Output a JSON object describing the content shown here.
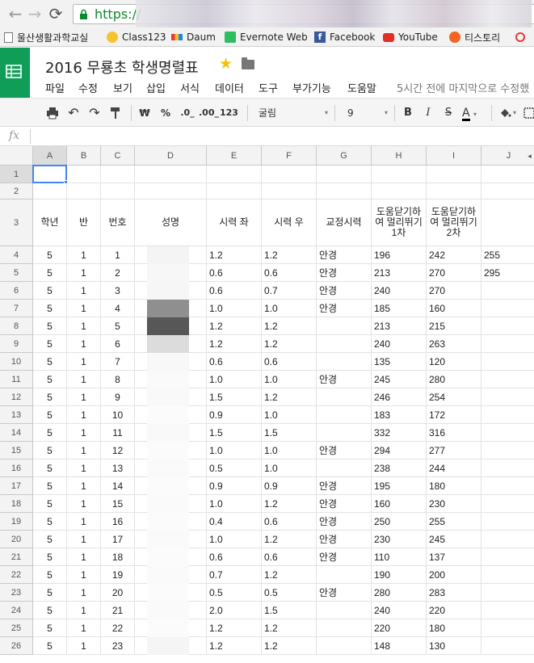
{
  "browser": {
    "url": "https://",
    "bookmarks": [
      {
        "label": "울산생활과학교실",
        "icon": "page-icon"
      },
      {
        "label": "Class123",
        "icon": "class123-icon"
      },
      {
        "label": "Daum",
        "icon": "daum-icon"
      },
      {
        "label": "Evernote Web",
        "icon": "evernote-icon"
      },
      {
        "label": "Facebook",
        "icon": "facebook-icon"
      },
      {
        "label": "YouTube",
        "icon": "youtube-icon"
      },
      {
        "label": "티스토리",
        "icon": "tistory-icon"
      }
    ]
  },
  "doc": {
    "title": "2016 무룡초 학생명렬표",
    "last_edit": "5시간 전에 마지막으로 수정했"
  },
  "menu": [
    "파일",
    "수정",
    "보기",
    "삽입",
    "서식",
    "데이터",
    "도구",
    "부가기능",
    "도움말"
  ],
  "toolbar": {
    "currency": "₩",
    "percent": "%",
    "decimal_decrease": ".0_",
    "decimal_increase": ".00_",
    "number_format": "123",
    "font": "굴림",
    "font_size": "9",
    "bold": "B",
    "italic": "I",
    "strike": "S",
    "text_color": "A"
  },
  "formula_bar": {
    "fx": "fx",
    "value": ""
  },
  "columns": [
    "A",
    "B",
    "C",
    "D",
    "E",
    "F",
    "G",
    "H",
    "I",
    "J"
  ],
  "header_row": [
    "학년",
    "반",
    "번호",
    "성명",
    "시력 좌",
    "시력 우",
    "교정시력",
    "도움닫기하여 멀리뛰기 1차",
    "도움닫기하여 멀리뛰기 2차",
    ""
  ],
  "row_numbers": [
    "1",
    "2",
    "3",
    "4",
    "5",
    "6",
    "7",
    "8",
    "9",
    "10",
    "11",
    "12",
    "13",
    "14",
    "15",
    "16",
    "17",
    "18",
    "19",
    "20",
    "21",
    "22",
    "23",
    "24",
    "25",
    "26"
  ],
  "rows": [
    [
      "5",
      "1",
      "1",
      "",
      "1.2",
      "1.2",
      "안경",
      "196",
      "242",
      "255"
    ],
    [
      "5",
      "1",
      "2",
      "",
      "0.6",
      "0.6",
      "안경",
      "213",
      "270",
      "295"
    ],
    [
      "5",
      "1",
      "3",
      "",
      "0.6",
      "0.7",
      "안경",
      "240",
      "270",
      ""
    ],
    [
      "5",
      "1",
      "4",
      "",
      "1.0",
      "1.0",
      "안경",
      "185",
      "160",
      ""
    ],
    [
      "5",
      "1",
      "5",
      "",
      "1.2",
      "1.2",
      "",
      "213",
      "215",
      ""
    ],
    [
      "5",
      "1",
      "6",
      "",
      "1.2",
      "1.2",
      "",
      "240",
      "263",
      ""
    ],
    [
      "5",
      "1",
      "7",
      "",
      "0.6",
      "0.6",
      "",
      "135",
      "120",
      ""
    ],
    [
      "5",
      "1",
      "8",
      "",
      "1.0",
      "1.0",
      "안경",
      "245",
      "280",
      ""
    ],
    [
      "5",
      "1",
      "9",
      "",
      "1.5",
      "1.2",
      "",
      "246",
      "254",
      ""
    ],
    [
      "5",
      "1",
      "10",
      "",
      "0.9",
      "1.0",
      "",
      "183",
      "172",
      ""
    ],
    [
      "5",
      "1",
      "11",
      "",
      "1.5",
      "1.5",
      "",
      "332",
      "316",
      ""
    ],
    [
      "5",
      "1",
      "12",
      "",
      "1.0",
      "1.0",
      "안경",
      "294",
      "277",
      ""
    ],
    [
      "5",
      "1",
      "13",
      "",
      "0.5",
      "1.0",
      "",
      "238",
      "244",
      ""
    ],
    [
      "5",
      "1",
      "14",
      "",
      "0.9",
      "0.9",
      "안경",
      "195",
      "180",
      ""
    ],
    [
      "5",
      "1",
      "15",
      "",
      "1.0",
      "1.2",
      "안경",
      "160",
      "230",
      ""
    ],
    [
      "5",
      "1",
      "16",
      "",
      "0.4",
      "0.6",
      "안경",
      "250",
      "255",
      ""
    ],
    [
      "5",
      "1",
      "17",
      "",
      "1.0",
      "1.2",
      "안경",
      "230",
      "245",
      ""
    ],
    [
      "5",
      "1",
      "18",
      "",
      "0.6",
      "0.6",
      "안경",
      "110",
      "137",
      ""
    ],
    [
      "5",
      "1",
      "19",
      "",
      "0.7",
      "1.2",
      "",
      "190",
      "200",
      ""
    ],
    [
      "5",
      "1",
      "20",
      "",
      "0.5",
      "0.5",
      "안경",
      "280",
      "283",
      ""
    ],
    [
      "5",
      "1",
      "21",
      "",
      "2.0",
      "1.5",
      "",
      "240",
      "220",
      ""
    ],
    [
      "5",
      "1",
      "22",
      "",
      "1.2",
      "1.2",
      "",
      "220",
      "180",
      ""
    ],
    [
      "5",
      "1",
      "23",
      "",
      "1.2",
      "1.2",
      "",
      "148",
      "130",
      ""
    ]
  ]
}
